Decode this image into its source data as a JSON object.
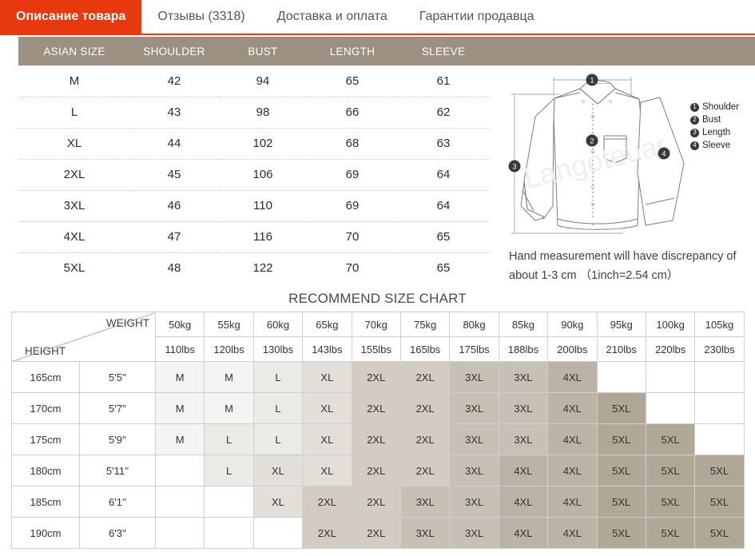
{
  "tabs": [
    {
      "label": "Описание товара",
      "active": true
    },
    {
      "label": "Отзывы (3318)",
      "active": false
    },
    {
      "label": "Доставка и оплата",
      "active": false
    },
    {
      "label": "Гарантии продавца",
      "active": false
    }
  ],
  "colors": {
    "accent": "#e8380d",
    "header_bar": "#9b9082",
    "badge": "#3a3a3a"
  },
  "size_table": {
    "columns": [
      "ASIAN SIZE",
      "SHOULDER",
      "BUST",
      "LENGTH",
      "SLEEVE"
    ],
    "rows": [
      [
        "M",
        "42",
        "94",
        "65",
        "61"
      ],
      [
        "L",
        "43",
        "98",
        "66",
        "62"
      ],
      [
        "XL",
        "44",
        "102",
        "68",
        "63"
      ],
      [
        "2XL",
        "45",
        "106",
        "69",
        "64"
      ],
      [
        "3XL",
        "46",
        "110",
        "69",
        "64"
      ],
      [
        "4XL",
        "47",
        "116",
        "70",
        "65"
      ],
      [
        "5XL",
        "48",
        "122",
        "70",
        "65"
      ]
    ]
  },
  "diagram": {
    "callouts": [
      "1",
      "2",
      "3",
      "4"
    ],
    "legend": [
      {
        "num": "1",
        "label": "Shoulder"
      },
      {
        "num": "2",
        "label": "Bust"
      },
      {
        "num": "3",
        "label": "Length"
      },
      {
        "num": "4",
        "label": "Sleeve"
      }
    ],
    "watermark": "Langoteuar",
    "note_line1": "Hand measurement will have discrepancy of",
    "note_line2": "about 1-3 cm （1inch=2.54 cm）"
  },
  "recommend": {
    "title": "RECOMMEND SIZE CHART",
    "corner": {
      "weight_label": "WEIGHT",
      "height_label": "HEIGHT"
    },
    "weight_kg": [
      "50kg",
      "55kg",
      "60kg",
      "65kg",
      "70kg",
      "75kg",
      "80kg",
      "85kg",
      "90kg",
      "95kg",
      "100kg",
      "105kg"
    ],
    "weight_lbs": [
      "110lbs",
      "120lbs",
      "130lbs",
      "143lbs",
      "155lbs",
      "165lbs",
      "175lbs",
      "188lbs",
      "200lbs",
      "210lbs",
      "220lbs",
      "230lbs"
    ],
    "rows": [
      {
        "cm": "165cm",
        "ft": "5'5''",
        "cells": [
          "M",
          "M",
          "L",
          "XL",
          "2XL",
          "2XL",
          "3XL",
          "3XL",
          "4XL",
          "",
          "",
          ""
        ]
      },
      {
        "cm": "170cm",
        "ft": "5'7''",
        "cells": [
          "M",
          "M",
          "L",
          "XL",
          "2XL",
          "2XL",
          "3XL",
          "3XL",
          "4XL",
          "5XL",
          "",
          ""
        ]
      },
      {
        "cm": "175cm",
        "ft": "5'9''",
        "cells": [
          "M",
          "L",
          "L",
          "XL",
          "2XL",
          "2XL",
          "3XL",
          "3XL",
          "4XL",
          "5XL",
          "5XL",
          ""
        ]
      },
      {
        "cm": "180cm",
        "ft": "5'11''",
        "cells": [
          "",
          "L",
          "XL",
          "XL",
          "2XL",
          "2XL",
          "3XL",
          "4XL",
          "4XL",
          "5XL",
          "5XL",
          "5XL"
        ]
      },
      {
        "cm": "185cm",
        "ft": "6'1''",
        "cells": [
          "",
          "",
          "XL",
          "2XL",
          "2XL",
          "3XL",
          "3XL",
          "4XL",
          "4XL",
          "5XL",
          "5XL",
          "5XL"
        ]
      },
      {
        "cm": "190cm",
        "ft": "6'3''",
        "cells": [
          "",
          "",
          "",
          "2XL",
          "2XL",
          "3XL",
          "3XL",
          "4XL",
          "4XL",
          "5XL",
          "5XL",
          "5XL"
        ]
      }
    ]
  }
}
